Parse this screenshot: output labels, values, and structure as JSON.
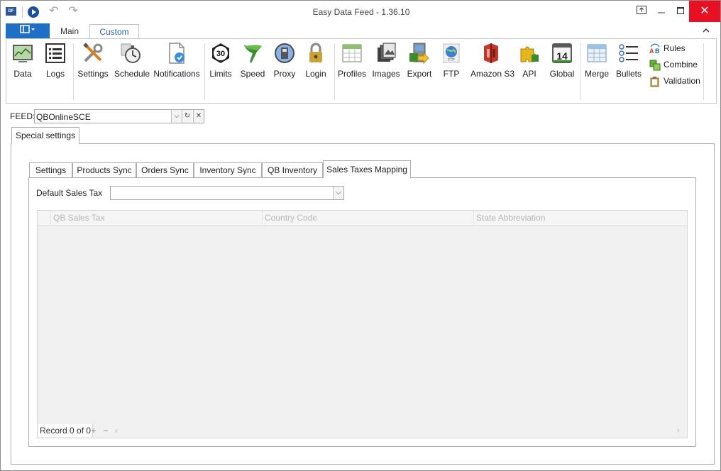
{
  "window": {
    "title": "Easy Data Feed - 1.36.10",
    "app_icon_text": "DF"
  },
  "ribbon_tabs": {
    "main": "Main",
    "custom": "Custom"
  },
  "ribbon": {
    "groups": [
      [
        {
          "label": "Data",
          "icon": "chart-monitor-icon"
        },
        {
          "label": "Logs",
          "icon": "list-icon"
        }
      ],
      [
        {
          "label": "Settings",
          "icon": "tools-icon"
        },
        {
          "label": "Schedule",
          "icon": "stopwatch-icon"
        },
        {
          "label": "Notifications",
          "icon": "notification-doc-icon"
        }
      ],
      [
        {
          "label": "Limits",
          "icon": "speed-limit-icon"
        },
        {
          "label": "Speed",
          "icon": "flag-icon"
        },
        {
          "label": "Proxy",
          "icon": "proxy-icon"
        },
        {
          "label": "Login",
          "icon": "padlock-icon"
        }
      ],
      [
        {
          "label": "Profiles",
          "icon": "table-icon"
        },
        {
          "label": "Images",
          "icon": "images-icon"
        },
        {
          "label": "Export",
          "icon": "export-icon"
        },
        {
          "label": "FTP",
          "icon": "ftp-globe-icon"
        },
        {
          "label": "Amazon S3",
          "icon": "amazon-s3-icon"
        },
        {
          "label": "API",
          "icon": "puzzle-icon"
        },
        {
          "label": "Global",
          "icon": "calendar-icon"
        }
      ],
      [
        {
          "label": "Merge",
          "icon": "grid-merge-icon"
        },
        {
          "label": "Bullets",
          "icon": "bullets-icon"
        }
      ]
    ],
    "calendar_day": "14",
    "limits_value": "30",
    "small_buttons": [
      {
        "label": "Rules",
        "icon": "rules-ab-icon"
      },
      {
        "label": "Combine",
        "icon": "combine-icon"
      },
      {
        "label": "Validation",
        "icon": "validation-clipboard-icon"
      }
    ]
  },
  "feed": {
    "label": "FEED:",
    "value": "QBOnlineSCE"
  },
  "special_tab": "Special settings",
  "inner_tabs": [
    "Settings",
    "Products Sync",
    "Orders Sync",
    "Inventory Sync",
    "QB Inventory",
    "Sales Taxes Mapping"
  ],
  "default_sales_tax": {
    "label": "Default Sales Tax",
    "value": ""
  },
  "grid": {
    "columns": [
      "QB Sales Tax",
      "Country Code",
      "State Abbreviation"
    ],
    "record_text": "Record 0 of 0"
  },
  "colors": {
    "accent": "#1f6fc5",
    "close": "#e81123"
  }
}
